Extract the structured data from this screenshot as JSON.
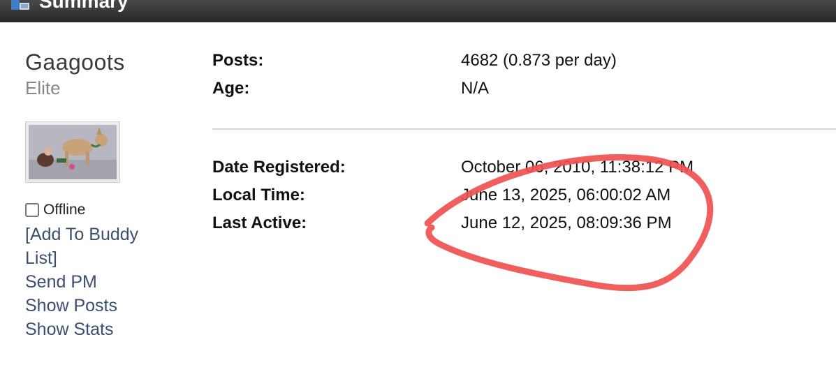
{
  "header": {
    "title": "Summary",
    "icon": "members-icon"
  },
  "profile": {
    "username": "Gaagoots",
    "rank": "Elite",
    "avatar_alt": "avatar",
    "status": "Offline"
  },
  "actions": {
    "add_buddy": "[Add To Buddy List]",
    "send_pm": "Send PM",
    "show_posts": "Show Posts",
    "show_stats": "Show Stats"
  },
  "stats": {
    "posts": {
      "label": "Posts:",
      "value": "4682 (0.873 per day)"
    },
    "age": {
      "label": "Age:",
      "value": "N/A"
    },
    "date_registered": {
      "label": "Date Registered:",
      "value": "October 06, 2010, 11:38:12 PM"
    },
    "local_time": {
      "label": "Local Time:",
      "value": "June 13, 2025, 06:00:02 AM"
    },
    "last_active": {
      "label": "Last Active:",
      "value": "June 12, 2025, 08:09:36 PM"
    }
  },
  "colors": {
    "link": "#3b4f73",
    "annotation": "#f05050",
    "header": "#333333"
  }
}
